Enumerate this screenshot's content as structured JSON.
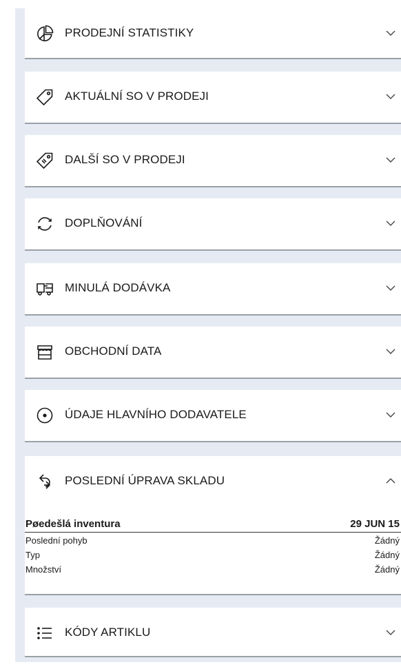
{
  "panels": [
    {
      "title": "PRODEJNÍ STATISTIKY",
      "icon": "pie-chart-icon",
      "expanded": false
    },
    {
      "title": "AKTUÁLNÍ SO V PRODEJI",
      "icon": "tag-icon",
      "expanded": false
    },
    {
      "title": "DALŠÍ SO V PRODEJI",
      "icon": "double-tag-icon",
      "expanded": false
    },
    {
      "title": "DOPLŇOVÁNÍ",
      "icon": "refresh-icon",
      "expanded": false
    },
    {
      "title": "MINULÁ DODÁVKA",
      "icon": "truck-icon",
      "expanded": false
    },
    {
      "title": "OBCHODNÍ DATA",
      "icon": "store-icon",
      "expanded": false
    },
    {
      "title": "ÚDAJE HLAVNÍHO DODAVATELE",
      "icon": "target-icon",
      "expanded": false
    },
    {
      "title": "POSLEDNÍ ÚPRAVA SKLADU",
      "icon": "swap-arrows-icon",
      "expanded": true
    },
    {
      "title": "KÓDY ARTIKLU",
      "icon": "list-icon",
      "expanded": false
    }
  ],
  "stock_adjustment": {
    "header_label": "Pøedešlá inventura",
    "header_value": "29 JUN 15",
    "rows": [
      {
        "label": "Poslední pohyb",
        "value": "Žádný"
      },
      {
        "label": "Typ",
        "value": "Žádný"
      },
      {
        "label": "Množství",
        "value": "Žádný"
      }
    ]
  }
}
